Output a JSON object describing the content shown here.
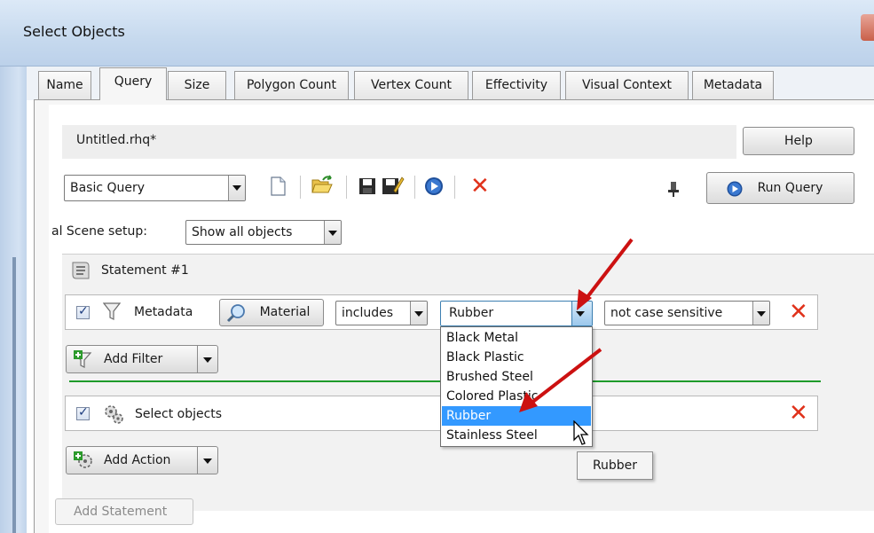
{
  "window": {
    "title": "Select Objects"
  },
  "tabs": [
    {
      "label": "Name"
    },
    {
      "label": "Query"
    },
    {
      "label": "Size"
    },
    {
      "label": "Polygon Count"
    },
    {
      "label": "Vertex Count"
    },
    {
      "label": "Effectivity"
    },
    {
      "label": "Visual Context"
    },
    {
      "label": "Metadata"
    }
  ],
  "file": {
    "name": "Untitled.rhq*",
    "help_label": "Help"
  },
  "toolbar": {
    "query_type": "Basic Query",
    "icons": [
      "new-file-icon",
      "open-folder-icon",
      "save-icon",
      "save-as-icon",
      "run-icon",
      "delete-icon"
    ],
    "run_query_label": "Run Query"
  },
  "scene": {
    "label": "al Scene setup:",
    "value": "Show all objects"
  },
  "statement": {
    "title": "Statement #1",
    "filter": {
      "checked": true,
      "kind": "Metadata",
      "field_button": "Material",
      "operator": "includes",
      "value": "Rubber",
      "case": "not case sensitive"
    },
    "add_filter_label": "Add Filter",
    "action": {
      "checked": true,
      "label": "Select objects"
    },
    "add_action_label": "Add Action"
  },
  "dropdown": {
    "options": [
      "Black Metal",
      "Black Plastic",
      "Brushed Steel",
      "Colored Plastic",
      "Rubber",
      "Stainless Steel"
    ],
    "selected_index": 4
  },
  "tooltip": {
    "text": "Rubber"
  },
  "add_statement_label": "Add Statement",
  "colors": {
    "accent": "#3399ff",
    "delete": "#e0321b",
    "annotation_arrow": "#cc1111",
    "divider": "#1e9b2a"
  }
}
